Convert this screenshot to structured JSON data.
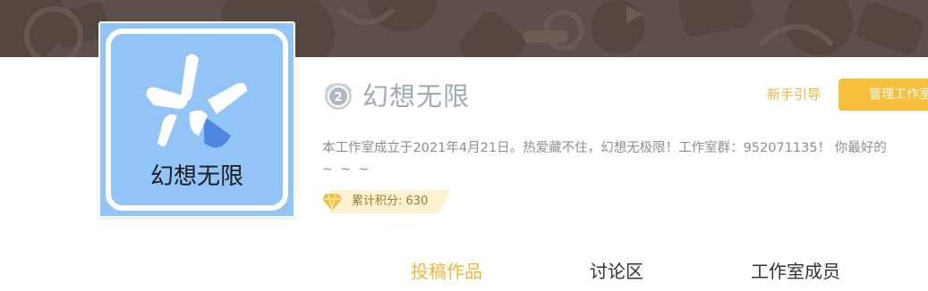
{
  "studio": {
    "name": "幻想无限",
    "level": "2",
    "logo_text": "幻想无限",
    "description": "本工作室成立于2021年4月21日。热爱藏不住，幻想无极限！工作室群：952071135！ 你最好的",
    "description_line2": "~ ~ ~",
    "points_label": "累计积分: 630"
  },
  "header": {
    "guide_label": "新手引导",
    "manage_label": "管理工作室"
  },
  "tabs": [
    {
      "label": "投稿作品",
      "active": true
    },
    {
      "label": "讨论区",
      "active": false
    },
    {
      "label": "工作室成员",
      "active": false
    }
  ],
  "colors": {
    "accent": "#f3b637",
    "banner": "#5e4f4d",
    "avatar_bg": "#93c4f8",
    "name": "#9eaab8"
  }
}
